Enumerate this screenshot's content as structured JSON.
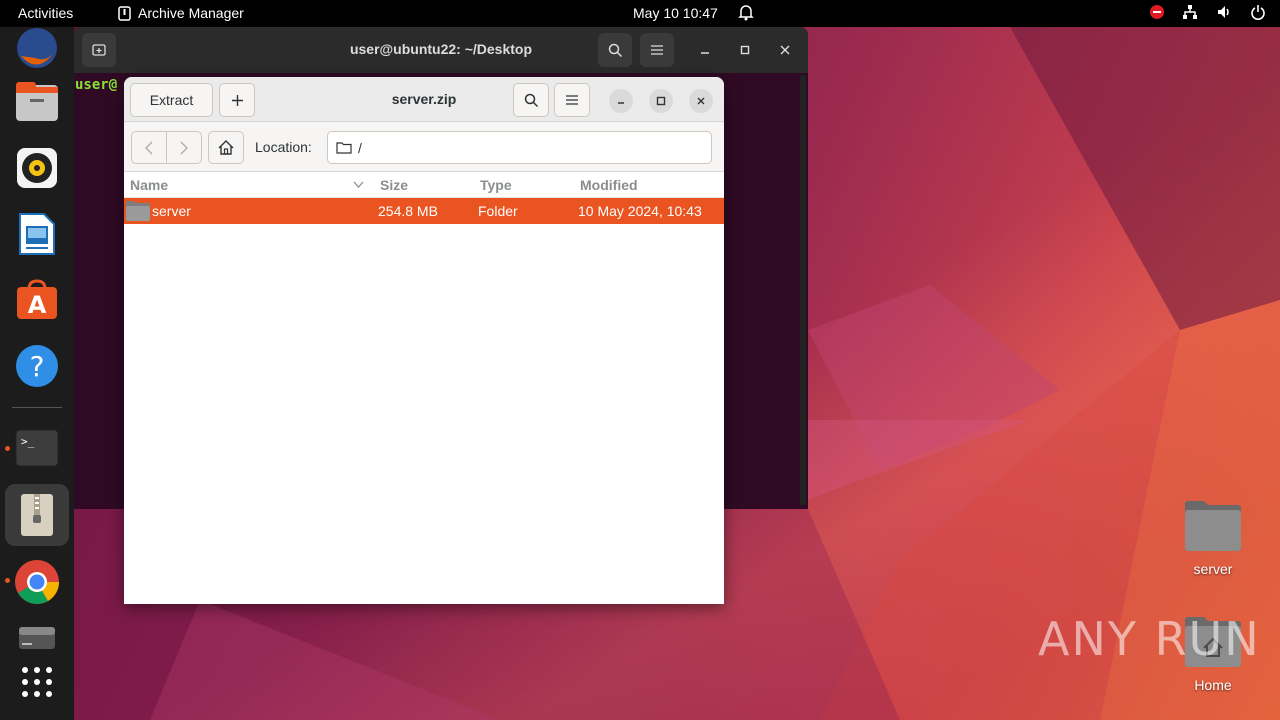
{
  "topbar": {
    "activities": "Activities",
    "app_name": "Archive Manager",
    "clock": "May 10  10:47"
  },
  "dock": {
    "apps": [
      "firefox",
      "files",
      "rhythmbox",
      "libreoffice-writer",
      "ubuntu-software",
      "help",
      "terminal",
      "archive-manager",
      "chrome",
      "drive",
      "show-apps"
    ]
  },
  "terminal": {
    "title": "user@ubuntu22: ~/Desktop",
    "prompt": "user@"
  },
  "archive": {
    "extract_label": "Extract",
    "title": "server.zip",
    "location_label": "Location:",
    "location_value": "/",
    "columns": {
      "name": "Name",
      "size": "Size",
      "type": "Type",
      "modified": "Modified"
    },
    "rows": [
      {
        "name": "server",
        "size": "254.8 MB",
        "type": "Folder",
        "modified": "10 May 2024, 10:43"
      }
    ]
  },
  "desktop": {
    "icons": [
      {
        "label": "server"
      },
      {
        "label": "Home"
      }
    ]
  },
  "watermark": "ANY RUN"
}
